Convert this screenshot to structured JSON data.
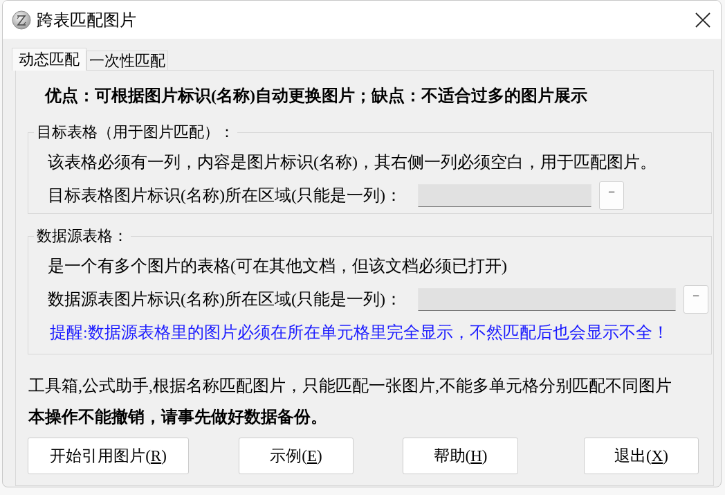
{
  "window": {
    "title": "跨表匹配图片"
  },
  "tabs": [
    {
      "label": "动态匹配",
      "selected": true
    },
    {
      "label": "一次性匹配",
      "selected": false
    }
  ],
  "summary": "优点：可根据图片标识(名称)自动更换图片；缺点：不适合过多的图片展示",
  "groups": [
    {
      "legend": "目标表格（用于图片匹配）：",
      "rows": [
        {
          "kind": "text",
          "text": "该表格必须有一列，内容是图片标识(名称)，其右侧一列必须空白，用于匹配图片。"
        },
        {
          "kind": "field",
          "label": "目标表格图片标识(名称)所在区域(只能是一列)：",
          "button": "−"
        }
      ]
    },
    {
      "legend": "数据源表格：",
      "rows": [
        {
          "kind": "text",
          "text": "是一个有多个图片的表格(可在其他文档，但该文档必须已打开)"
        },
        {
          "kind": "field",
          "label": "数据源表图片标识(名称)所在区域(只能是一列)：",
          "button": "−"
        },
        {
          "kind": "note",
          "text": "提醒:数据源表格里的图片必须在所在单元格里完全显示，不然匹配后也会显示不全！"
        }
      ]
    }
  ],
  "footer_lines": [
    {
      "kind": "info",
      "text": "工具箱,公式助手,根据名称匹配图片，只能匹配一张图片,不能多单元格分别匹配不同图片"
    },
    {
      "kind": "warning",
      "text": "本操作不能撤销，请事先做好数据备份。"
    }
  ],
  "buttons": [
    {
      "label": "开始引用图片(",
      "access_key": "R",
      "label_end": ")"
    },
    {
      "label": "示例(",
      "access_key": "E",
      "label_end": ")"
    },
    {
      "label": "帮助(",
      "access_key": "H",
      "label_end": ")"
    },
    {
      "label": "退出(",
      "access_key": "X",
      "label_end": ")"
    }
  ]
}
